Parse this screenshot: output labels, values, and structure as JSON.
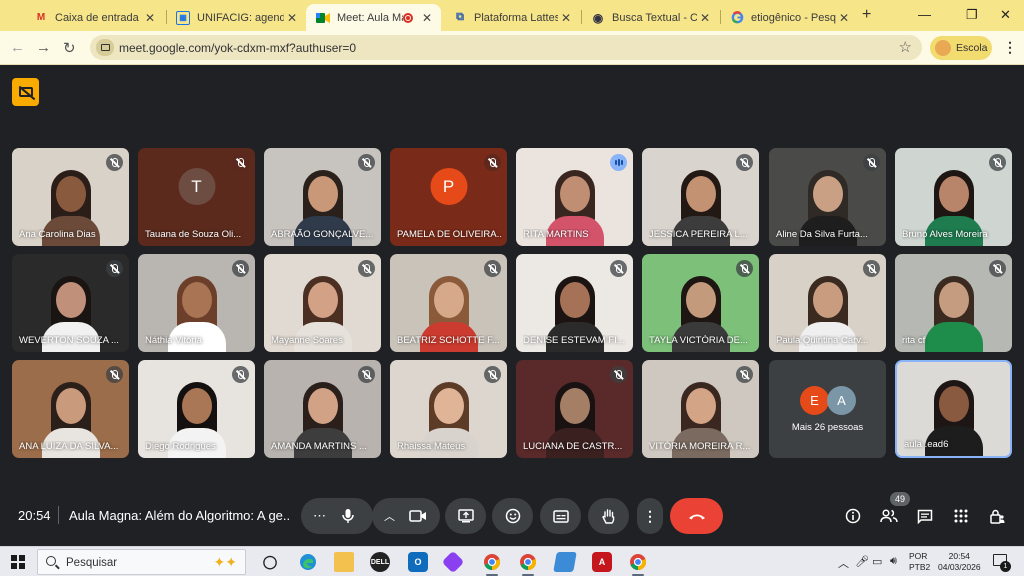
{
  "browser": {
    "tabs": [
      {
        "title": "Caixa de entrada (229",
        "icon": "gmail-icon"
      },
      {
        "title": "UNIFACIG: agenda - c",
        "icon": "calendar-icon"
      },
      {
        "title": "Meet: Aula Magn",
        "icon": "meet-icon",
        "active": true
      },
      {
        "title": "Plataforma Lattes",
        "icon": "lattes-icon"
      },
      {
        "title": "Busca Textual - Currí",
        "icon": "globe-icon"
      },
      {
        "title": "etiogênico - Pesquisa",
        "icon": "google-icon"
      }
    ],
    "url": "meet.google.com/yok-cdxm-mxf?authuser=0",
    "profile_label": "Escola"
  },
  "meet": {
    "tiles": [
      {
        "name": "Ana Carolina Dias",
        "kind": "video",
        "bg": "#d9d2c8",
        "hair": "#2b1d18",
        "skin": "#8a5a3e",
        "shirt": "#6b4a3a",
        "mic": "muted"
      },
      {
        "name": "Tauana de Souza Oli...",
        "kind": "avatar",
        "letter": "T",
        "bg": "#5b2a1c",
        "avatar_color": "#6d4c41",
        "mic": "muted-red"
      },
      {
        "name": "ABRAÃO GONÇALVE...",
        "kind": "video",
        "bg": "#c7c3be",
        "hair": "#2a211c",
        "skin": "#c99878",
        "shirt": "#2f3a4a",
        "mic": "muted"
      },
      {
        "name": "PAMELA DE OLIVEIRA...",
        "kind": "avatar",
        "letter": "P",
        "bg": "#7a2a18",
        "avatar_color": "#e64a19",
        "mic": "muted-red"
      },
      {
        "name": "RITA MARTINS",
        "kind": "video",
        "bg": "#ebe3de",
        "hair": "#3a2620",
        "skin": "#c08e72",
        "shirt": "#d3536b",
        "mic": "speaking"
      },
      {
        "name": "JESSICA PEREIRA L...",
        "kind": "video",
        "bg": "#dad4ce",
        "hair": "#221814",
        "skin": "#c29273",
        "shirt": "#3c3c3c",
        "mic": "muted"
      },
      {
        "name": "Aline Da Silva Furta...",
        "kind": "video",
        "bg": "#4a4a48",
        "hair": "#2f2a26",
        "skin": "#c9a083",
        "shirt": "#1e1e1e",
        "mic": "muted"
      },
      {
        "name": "Bruno Alves Moreira",
        "kind": "video",
        "bg": "#cfd6d1",
        "hair": "#1d1612",
        "skin": "#b9856a",
        "shirt": "#1e7c4f",
        "mic": "muted"
      },
      {
        "name": "WEVERTON SOUZA ...",
        "kind": "video",
        "bg": "#2a2a2a",
        "hair": "#1a1412",
        "skin": "#c0907a",
        "shirt": "#f1f1f1",
        "mic": "muted"
      },
      {
        "name": "Náthia Vitória",
        "kind": "video",
        "bg": "#b9b5b0",
        "hair": "#6b3f2a",
        "skin": "#a97454",
        "shirt": "#ffffff",
        "mic": "muted"
      },
      {
        "name": "Mayanne Soares",
        "kind": "video",
        "bg": "#e1dad2",
        "hair": "#4a2f22",
        "skin": "#d3a286",
        "shirt": "#e6e1db",
        "mic": "muted"
      },
      {
        "name": "BEATRIZ SCHOTTE F...",
        "kind": "video",
        "bg": "#c9c3b9",
        "hair": "#8a5a3a",
        "skin": "#d5a989",
        "shirt": "#cc3b2f",
        "mic": "muted"
      },
      {
        "name": "DENISE ESTEVAM FI...",
        "kind": "video",
        "bg": "#ece8e4",
        "hair": "#1c1412",
        "skin": "#a57257",
        "shirt": "#2b2b2b",
        "mic": "muted"
      },
      {
        "name": "TAYLA VICTÓRIA DE...",
        "kind": "video",
        "bg": "#7cc07a",
        "hair": "#1d1612",
        "skin": "#c49a7c",
        "shirt": "#3a3a3a",
        "mic": "muted"
      },
      {
        "name": "Paula Quintina Carv...",
        "kind": "video",
        "bg": "#d7d1c8",
        "hair": "#3b2a20",
        "skin": "#c99c80",
        "shirt": "#efefef",
        "mic": "muted"
      },
      {
        "name": "rita cf",
        "kind": "video",
        "bg": "#b6b9b3",
        "hair": "#3a2a20",
        "skin": "#c69c80",
        "shirt": "#1e8c4a",
        "mic": "muted"
      },
      {
        "name": "ANA LUIZA DA SILVA...",
        "kind": "video",
        "bg": "#9b6d4a",
        "hair": "#2b1f1a",
        "skin": "#c99a7c",
        "shirt": "#e8e5e0",
        "mic": "muted"
      },
      {
        "name": "Diego Rodrigues",
        "kind": "video",
        "bg": "#e7e4df",
        "hair": "#151010",
        "skin": "#a97656",
        "shirt": "#f3f3f3",
        "mic": "muted"
      },
      {
        "name": "AMANDA MARTINS ...",
        "kind": "video",
        "bg": "#b8b3ae",
        "hair": "#2a1f1a",
        "skin": "#d1a286",
        "shirt": "#3d3d3d",
        "mic": "muted"
      },
      {
        "name": "Rhaissa Mateus",
        "kind": "video",
        "bg": "#dcd6cf",
        "hair": "#5c3b27",
        "skin": "#e0b497",
        "shirt": "#d8d3cd",
        "mic": "muted"
      },
      {
        "name": "LUCIANA DE CASTR...",
        "kind": "video",
        "bg": "#5a2a2a",
        "hair": "#1a1212",
        "skin": "#a57e66",
        "shirt": "#3b2020",
        "mic": "muted"
      },
      {
        "name": "VITÓRIA MOREIRA R...",
        "kind": "video",
        "bg": "#cfc8c0",
        "hair": "#3a2820",
        "skin": "#d3a486",
        "shirt": "#7a6a60",
        "mic": "muted"
      },
      {
        "name": "Mais 26 pessoas",
        "kind": "more",
        "letters": [
          "E",
          "A"
        ],
        "colors": [
          "#e64a19",
          "#7b96a6"
        ],
        "bg": "#3c4043"
      },
      {
        "name": "aula .ead6",
        "kind": "self",
        "bg": "#dcdad6",
        "hair": "#1e1614",
        "skin": "#8a5a40",
        "shirt": "#1d1d1d"
      }
    ]
  },
  "controls": {
    "time": "20:54",
    "meeting_title": "Aula Magna: Além do Algoritmo: A ge...",
    "participants_count": "49"
  },
  "taskbar": {
    "search_placeholder": "Pesquisar",
    "lang_top": "POR",
    "lang_bottom": "PTB2",
    "time": "20:54",
    "date": "04/03/2026",
    "notifications": "1"
  }
}
